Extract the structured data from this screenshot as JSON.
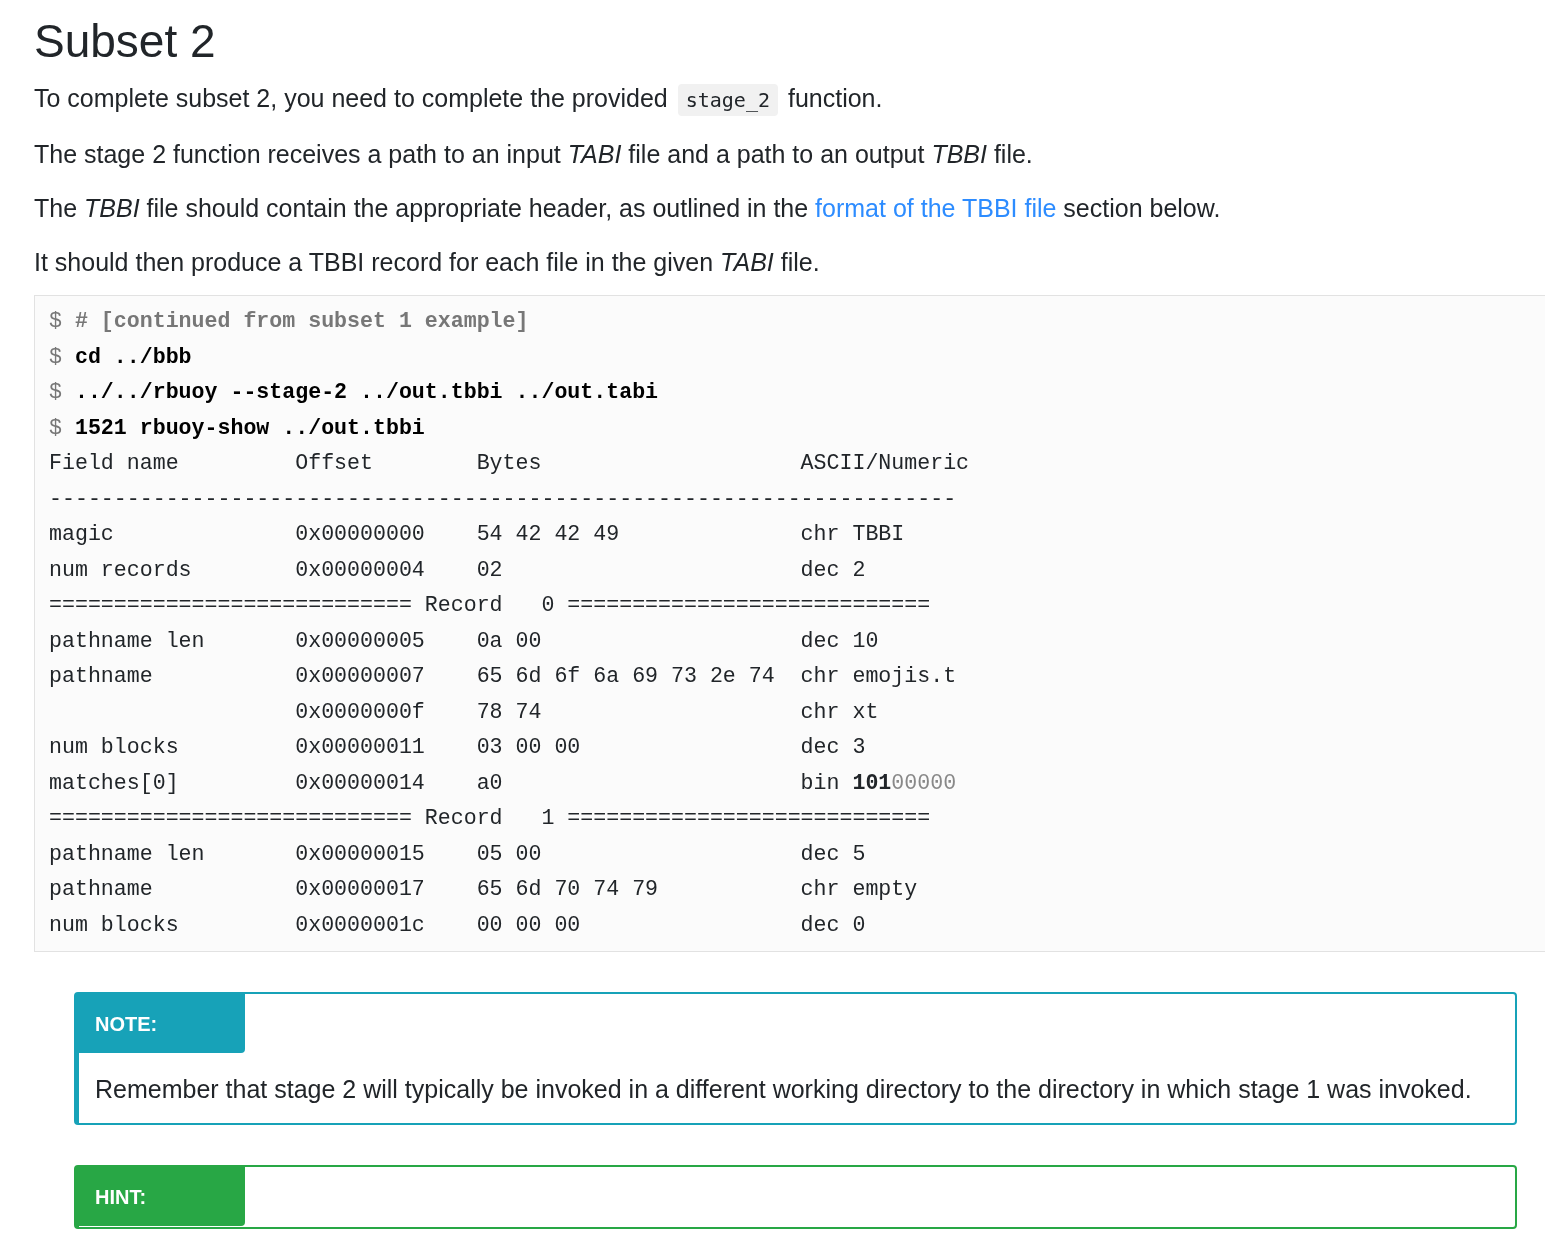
{
  "heading": "Subset 2",
  "paragraphs": [
    {
      "text": "To complete subset 2, you need to complete the provided ",
      "code": "stage_2",
      "after": " function."
    },
    {
      "text": "The stage 2 function receives a path to an input *TABI* file and a path to an output *TBBI* file."
    },
    {
      "text": "The *TBBI* file should contain the appropriate header, as outlined in the ",
      "link": "format of the TBBI file",
      "after": " section below."
    },
    {
      "text": "It should then produce a TBBI record for each file in the given *TABI* file."
    }
  ],
  "terminal": [
    {
      "kind": "comment",
      "prompt": "$",
      "text": "# [continued from subset 1 example]"
    },
    {
      "kind": "command",
      "prompt": "$",
      "text": "cd ../bbb"
    },
    {
      "kind": "command",
      "prompt": "$",
      "text": "../../rbuoy --stage-2 ../out.tbbi ../out.tabi"
    },
    {
      "kind": "command",
      "prompt": "$",
      "text": "1521 rbuoy-show ../out.tbbi"
    },
    {
      "kind": "output",
      "text": "Field name         Offset        Bytes                    ASCII/Numeric"
    },
    {
      "kind": "output",
      "text": "----------------------------------------------------------------------"
    },
    {
      "kind": "output",
      "text": "magic              0x00000000    54 42 42 49              chr TBBI"
    },
    {
      "kind": "output",
      "text": "num records        0x00000004    02                       dec 2"
    },
    {
      "kind": "output",
      "text": "============================ Record   0 ============================"
    },
    {
      "kind": "output",
      "text": "pathname len       0x00000005    0a 00                    dec 10"
    },
    {
      "kind": "output",
      "text": "pathname           0x00000007    65 6d 6f 6a 69 73 2e 74  chr emojis.t"
    },
    {
      "kind": "output",
      "text": "                   0x0000000f    78 74                    chr xt"
    },
    {
      "kind": "output",
      "text": "num blocks         0x00000011    03 00 00                 dec 3"
    },
    {
      "kind": "bits",
      "text": "matches[0]         0x00000014    a0                       bin ",
      "set": "101",
      "unset": "00000"
    },
    {
      "kind": "output",
      "text": "============================ Record   1 ============================"
    },
    {
      "kind": "output",
      "text": "pathname len       0x00000015    05 00                    dec 5"
    },
    {
      "kind": "output",
      "text": "pathname           0x00000017    65 6d 70 74 79           chr empty"
    },
    {
      "kind": "output",
      "text": "num blocks         0x0000001c    00 00 00                 dec 0"
    }
  ],
  "callouts": [
    {
      "kind": "note",
      "label": "NOTE:",
      "body": "Remember that stage 2 will typically be invoked in a different working directory to the directory in which stage 1 was invoked."
    },
    {
      "kind": "hint",
      "label": "HINT:"
    }
  ]
}
